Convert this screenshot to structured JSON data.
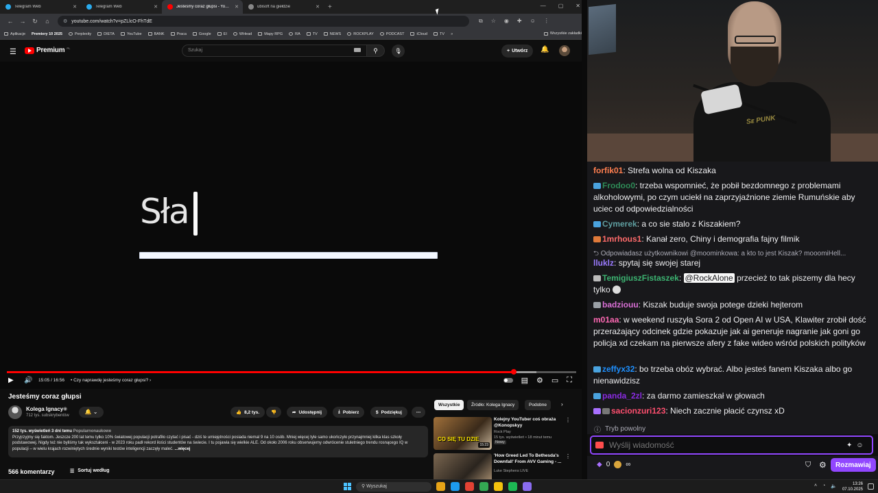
{
  "browser": {
    "tabs": [
      {
        "label": "Telegram Web",
        "color": "#2aabee",
        "active": false
      },
      {
        "label": "Telegram Web",
        "color": "#2aabee",
        "active": false
      },
      {
        "label": "Jesteśmy coraz głupsi - YouTube",
        "color": "#ff0000",
        "active": true
      },
      {
        "label": "ubisoft na giełdzie",
        "color": "#888888",
        "active": false
      }
    ],
    "new_tab": "+",
    "window_controls": [
      "—",
      "▢",
      "✕"
    ],
    "url": "youtube.com/watch?v=pZLlcO-FhTdE",
    "bookmarks": [
      "Aplikacje",
      "Premiery 10 2025",
      "Perplexity",
      "DIETA",
      "YouTube",
      "BANK",
      "Praca",
      "Google",
      "EI",
      "WHead",
      "Mapy RPG",
      "RA",
      "TV",
      "NEWS",
      "ROCKPLAY",
      "PODCAST",
      "iCloud",
      "TV"
    ],
    "bookmarks_more": "»",
    "bookmarks_all": "Wszystkie zakładki"
  },
  "youtube": {
    "logo_text": "Premium",
    "logo_suffix": "PL",
    "search_placeholder": "Szukaj",
    "create_label": "Utwórz",
    "video_overlay_text": "Sła",
    "player": {
      "time": "15:05 / 16:56",
      "chapter": "• Czy naprawdę jesteśmy coraz głupsi? ›",
      "progress": 0.89,
      "buffered": 0.93
    },
    "title": "Jesteśmy coraz głupsi",
    "channel": {
      "name": "Kolega Ignacy",
      "verified": "◉",
      "subs": "712 tys. subskrybentów"
    },
    "actions": {
      "likes": "8,2 tys.",
      "share": "Udostępnij",
      "download": "Pobierz",
      "thanks": "Podziękuj"
    },
    "description": {
      "stats": "152 tys. wyświetleń  3 dni temu",
      "tag": "Popularnonaukowe",
      "text": "Przyjrzyjmy się faktom. Jeszcze 200 lat temu tylko 10% światowej populacji potrafiło czytać i pisać - dziś te umiejętności posiada niemal 9 na 10 osób. Mniej więcej tyle samo ukończyło przynajmniej kilka klas szkoły podstawowej. Nigdy też nie byliśmy tak wykształceni - w 2023 roku padł rekord ilości studentów na świecie. I tu pojawia się wielkie ALE. Od około 2006 roku obserwujemy odwrócenie stuletniego trendu rosnącego IQ w populacji  – w wielu krajach rozwiniętych średnie wyniki testów inteligencji zaczęły maleć.",
      "more": "...więcej"
    },
    "comments_count": "566 komentarzy",
    "sort_label": "Sortuj według",
    "chips": [
      "Wszystkie",
      "Źródło: Kolega Ignacy",
      "Podobne"
    ],
    "related": [
      {
        "title": "Kolejny YouTuber coś obraża @Konopskyy",
        "channel": "Rock Play",
        "meta": "15 tys. wyświetleń • 18 minut temu",
        "badge": "Nowy",
        "duration": "15:23",
        "thumb_text": "CO SIĘ TU DZIE",
        "thumb_color": "#8a5a2a"
      },
      {
        "title": "'How Greed Led To Bethesda's Downfall' From AVV Gaming - ...",
        "channel": "Luke Stephens LIVE",
        "meta": "",
        "badge": "",
        "duration": "",
        "thumb_text": "",
        "thumb_color": "#6a5844"
      }
    ]
  },
  "chat": {
    "messages": [
      {
        "user": "forfik01",
        "color": "#ff7f50",
        "badge": "",
        "text": "Strefa wolna od Kiszaka"
      },
      {
        "user": "Frodoo0",
        "color": "#2e8b57",
        "badge": "#4aa3df",
        "text": "trzeba wspomnieć, że pobił bezdomnego z problemami alkoholowymi, po czym uciekł na zaprzyjaźnione ziemie Rumuńskie aby uciec od odpowiedzialności"
      },
      {
        "user": "Cymerek",
        "color": "#5f9ea0",
        "badge": "#4aa3df",
        "text": "a co sie stalo z Kiszakiem?"
      },
      {
        "user": "1mrhous1",
        "color": "#ff6b6b",
        "badge": "#e07a3a",
        "text": "Kanał zero, Chiny i demografia fajny filmik"
      },
      {
        "user": "lluklz",
        "color": "#9b7bff",
        "badge": "",
        "text": "spytaj się swojej starej",
        "reply": "Odpowiadasz użytkownikowi @moominkowa: a kto to jest Kiszak? mooomiHell..."
      },
      {
        "user": "TemigiuszFistaszek",
        "color": "#3cb371",
        "badge": "#bbbbbb",
        "mention": "@RockAlone",
        "text": "przecież to tak piszemy dla hecy tylko"
      },
      {
        "user": "badziouu",
        "color": "#da70d6",
        "badge": "#9aa0a6",
        "text": "Kiszak buduje swoja potege dzieki hejterom"
      },
      {
        "user": "m01aa",
        "color": "#ff69b4",
        "badge": "",
        "text": "w weekend ruszyła Sora 2 od Open AI w USA, Klawiter zrobił dość przerażający odcinek gdzie pokazuje jak ai generuje nagranie jak goni go policja xd czekam na pierwsze afery z fake wideo wśród polskich polityków"
      },
      {
        "user": "zeffyx32",
        "color": "#1e90ff",
        "badge": "#4aa3df",
        "text": "bo trzeba obóz wybrać. Albo jesteś fanem Kiszaka albo go nienawidzisz"
      },
      {
        "user": "panda_2zl",
        "color": "#8a2be2",
        "badge": "#4aa3df",
        "text": "za darmo zamieszkał w głowach"
      },
      {
        "user": "sacionzuri123",
        "color": "#ff4f6f",
        "badge": "#a970ff",
        "text": "Niech zacznie płacić czynsz xD"
      }
    ],
    "mode": "Tryb powolny",
    "input_placeholder": "Wyślij wiadomość",
    "bits": "0",
    "points": "∞",
    "send_label": "Rozmawiaj"
  },
  "camera": {
    "shirt_text": "Sᴇ PUNK"
  },
  "taskbar": {
    "search": "Wyszukaj",
    "apps": [
      "#e6a317",
      "#1d9bf0",
      "#e34234",
      "#34a853",
      "#f4c20d",
      "#1db954",
      "#8a6cf0"
    ],
    "time": "13:26",
    "date": "07.10.2025"
  }
}
